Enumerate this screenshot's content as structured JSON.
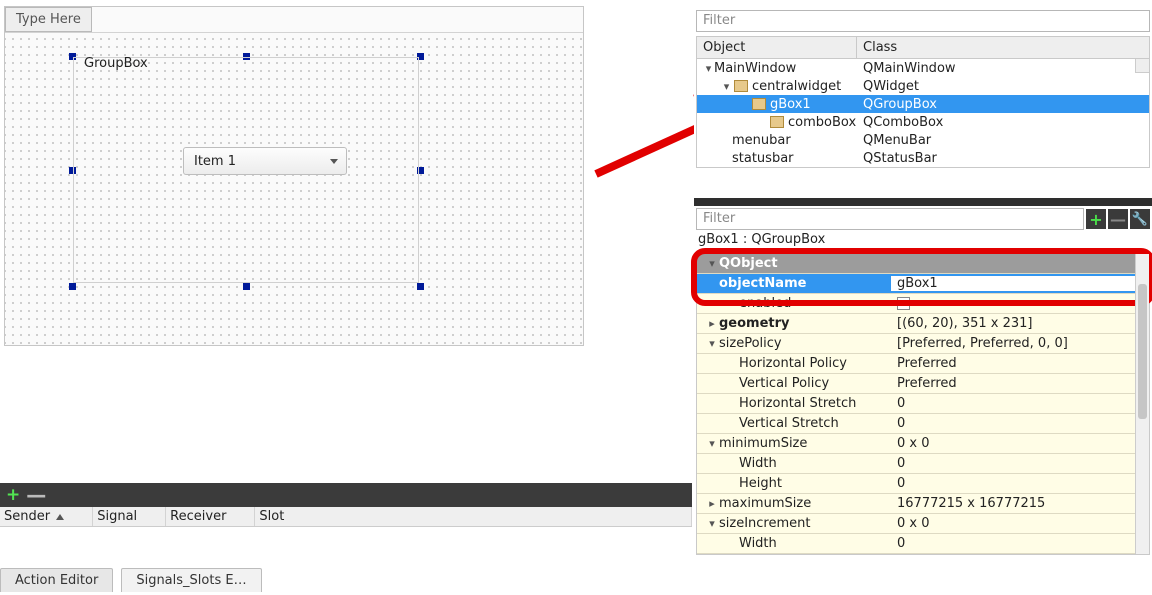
{
  "designer": {
    "type_here": "Type Here",
    "groupbox_title": "GroupBox",
    "combo_value": "Item 1"
  },
  "signals_panel": {
    "columns": [
      "Sender",
      "Signal",
      "Receiver",
      "Slot"
    ]
  },
  "tabs": {
    "action_editor": "Action Editor",
    "signals_slots": "Signals_Slots E…"
  },
  "object_inspector": {
    "filter_placeholder": "Filter",
    "columns": [
      "Object",
      "Class"
    ],
    "rows": [
      {
        "indent": 0,
        "twist": "▾",
        "icon": false,
        "obj": "MainWindow",
        "cls": "QMainWindow",
        "sel": false
      },
      {
        "indent": 1,
        "twist": "▾",
        "icon": true,
        "obj": "centralwidget",
        "cls": "QWidget",
        "sel": false
      },
      {
        "indent": 2,
        "twist": "",
        "icon": true,
        "obj": "gBox1",
        "cls": "QGroupBox",
        "sel": true
      },
      {
        "indent": 3,
        "twist": "",
        "icon": true,
        "obj": "comboBox",
        "cls": "QComboBox",
        "sel": false
      },
      {
        "indent": 1,
        "twist": "",
        "icon": false,
        "obj": "menubar",
        "cls": "QMenuBar",
        "sel": false
      },
      {
        "indent": 1,
        "twist": "",
        "icon": false,
        "obj": "statusbar",
        "cls": "QStatusBar",
        "sel": false
      }
    ]
  },
  "property_editor": {
    "filter_placeholder": "Filter",
    "context": "gBox1 : QGroupBox",
    "section_label": "QObject",
    "rows": [
      {
        "type": "selected",
        "key": "objectName",
        "val": "gBox1"
      },
      {
        "type": "plain",
        "twist": "",
        "indent": 1,
        "keybold": false,
        "key": "enabled",
        "val_checkbox": true
      },
      {
        "type": "plain",
        "twist": "▸",
        "indent": 0,
        "keybold": true,
        "key": "geometry",
        "val": "[(60, 20), 351 x 231]"
      },
      {
        "type": "plain",
        "twist": "▾",
        "indent": 0,
        "keybold": false,
        "key": "sizePolicy",
        "val": "[Preferred, Preferred, 0, 0]"
      },
      {
        "type": "plain",
        "twist": "",
        "indent": 1,
        "keybold": false,
        "key": "Horizontal Policy",
        "val": "Preferred"
      },
      {
        "type": "plain",
        "twist": "",
        "indent": 1,
        "keybold": false,
        "key": "Vertical Policy",
        "val": "Preferred"
      },
      {
        "type": "plain",
        "twist": "",
        "indent": 1,
        "keybold": false,
        "key": "Horizontal Stretch",
        "val": "0"
      },
      {
        "type": "plain",
        "twist": "",
        "indent": 1,
        "keybold": false,
        "key": "Vertical Stretch",
        "val": "0"
      },
      {
        "type": "plain",
        "twist": "▾",
        "indent": 0,
        "keybold": false,
        "key": "minimumSize",
        "val": "0 x 0"
      },
      {
        "type": "plain",
        "twist": "",
        "indent": 1,
        "keybold": false,
        "key": "Width",
        "val": "0"
      },
      {
        "type": "plain",
        "twist": "",
        "indent": 1,
        "keybold": false,
        "key": "Height",
        "val": "0"
      },
      {
        "type": "plain",
        "twist": "▸",
        "indent": 0,
        "keybold": false,
        "key": "maximumSize",
        "val": "16777215 x 16777215"
      },
      {
        "type": "plain",
        "twist": "▾",
        "indent": 0,
        "keybold": false,
        "key": "sizeIncrement",
        "val": "0 x 0"
      },
      {
        "type": "plain",
        "twist": "",
        "indent": 1,
        "keybold": false,
        "key": "Width",
        "val": "0"
      }
    ]
  }
}
